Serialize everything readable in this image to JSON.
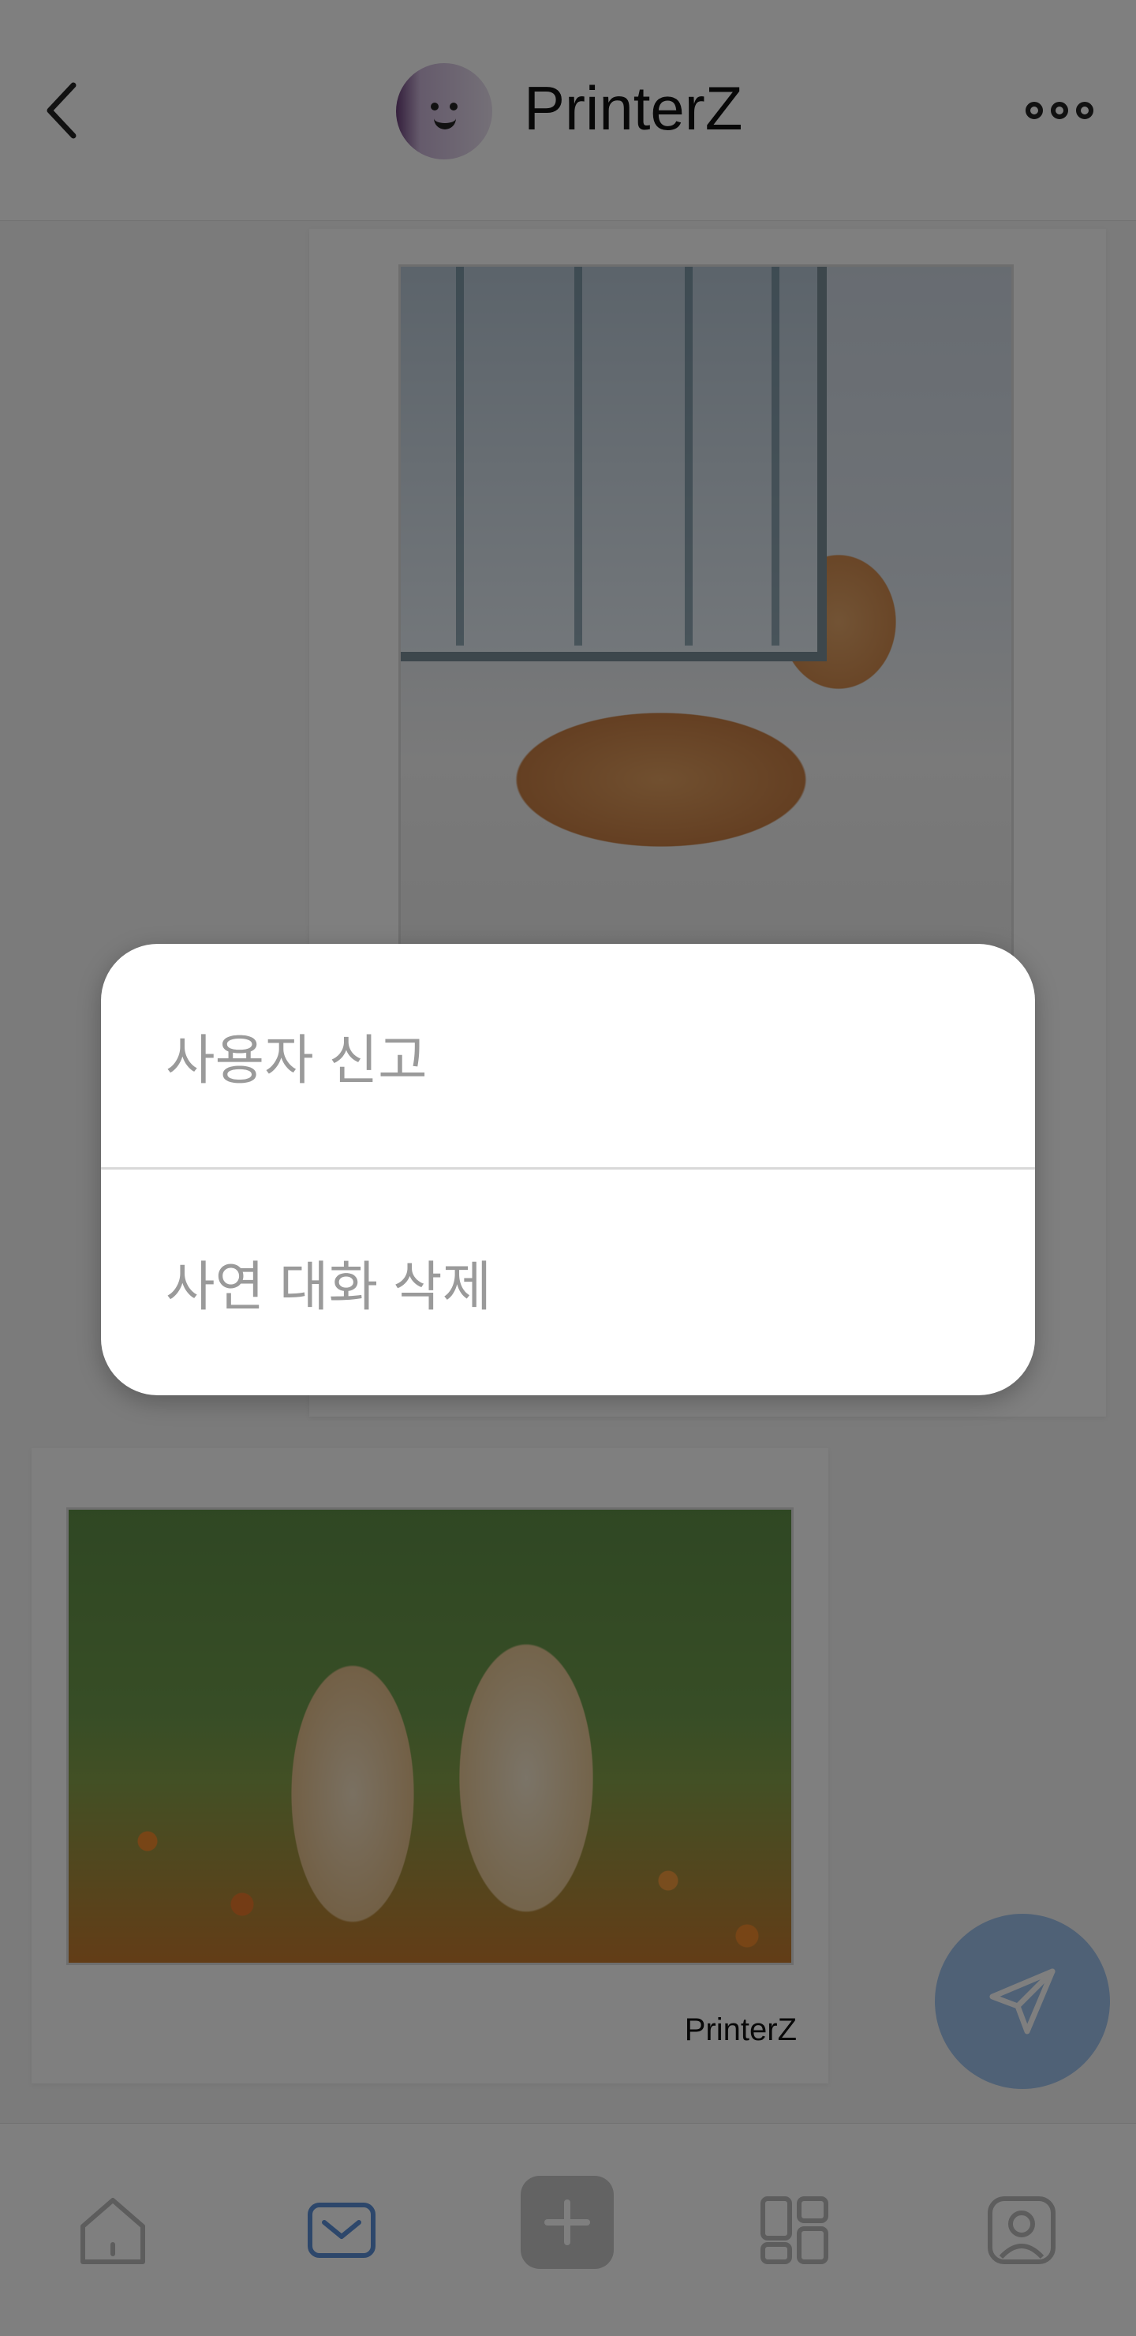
{
  "header": {
    "title": "PrinterZ",
    "back_icon": "chevron-left-icon",
    "more_icon": "more-horizontal-icon"
  },
  "messages": [
    {
      "image": "shiba-inu-dog-photo",
      "sender": ""
    },
    {
      "image": "golden-retriever-puppies-photo",
      "sender": "PrinterZ"
    }
  ],
  "fab": {
    "icon": "send-paper-plane-icon",
    "color": "#9fc3ec"
  },
  "bottom_nav": [
    "home-icon",
    "mail-icon",
    "add-icon",
    "grid-icon",
    "profile-icon"
  ],
  "popup": {
    "items": [
      "사용자 신고",
      "사연 대화 삭제"
    ]
  },
  "colors": {
    "overlay": "rgba(0,0,0,0.5)",
    "accent": "#5b8fd6"
  }
}
